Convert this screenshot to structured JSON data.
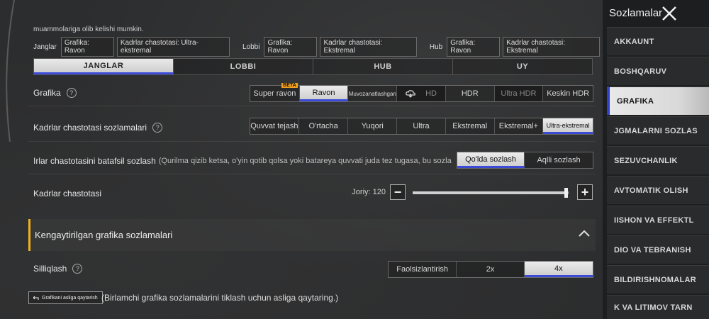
{
  "notice": "muammolariga olib kelishi mumkin.",
  "summary": [
    {
      "label": "Janglar",
      "chips": [
        "Grafika: Ravon",
        "Kadrlar chastotasi: Ultra-ekstremal"
      ]
    },
    {
      "label": "Lobbi",
      "chips": [
        "Grafika: Ravon",
        "Kadrlar chastotasi: Ekstremal"
      ]
    },
    {
      "label": "Hub",
      "chips": [
        "Grafika: Ravon",
        "Kadrlar chastotasi: Ekstremal"
      ]
    }
  ],
  "tabs": [
    "JANGLAR",
    "LOBBI",
    "HUB",
    "UY"
  ],
  "graphics": {
    "label": "Grafika",
    "options": [
      "Super ravon",
      "Ravon",
      "Muvozanatlashgan",
      "HD",
      "HDR",
      "Ultra HDR",
      "Keskin HDR"
    ],
    "badge": "BETA",
    "selected": "Ravon"
  },
  "framerate": {
    "label": "Kadrlar chastotasi sozlamalari",
    "options": [
      "Quvvat tejash",
      "O'rtacha",
      "Yuqori",
      "Ultra",
      "Ekstremal",
      "Ekstremal+",
      "Ultra-ekstremal"
    ],
    "selected": "Ultra-ekstremal"
  },
  "detail": {
    "label": "Irlar chastotasini batafsil sozlash",
    "note": "(Qurilma qizib ketsa, o'yin qotib qolsa yoki batareya quvvati juda tez tugasa, bu sozlamani pasaytiring)",
    "options": [
      "Qo'lda sozlash",
      "Aqlli sozlash"
    ],
    "selected": "Qo'lda sozlash"
  },
  "fps_slider": {
    "label": "Kadrlar chastotasi",
    "value_text": "Joriy: 120",
    "fraction": 0.98
  },
  "advanced": {
    "title": "Kengaytirilgan grafika sozlamalari"
  },
  "antialias": {
    "label": "Silliqlash",
    "options": [
      "Faolsizlantirish",
      "2x",
      "4x"
    ],
    "selected": "4x"
  },
  "reset": {
    "button": "Grafikani asliga qaytarish",
    "note": "(Birlamchi grafika sozlamalarini tiklash uchun asliga qaytaring.)"
  },
  "sidebar": {
    "title": "Sozlamalar",
    "items": [
      "AKKAUNT",
      "BOSHQARUV",
      "GRAFIKA",
      "JGMALARNI SOZLAS",
      "SEZUVCHANLIK",
      "AVTOMATIK OLISH",
      "IISHON VA EFFEKTL",
      "DIO VA TEBRANISH",
      "BILDIRISHNOMALAR",
      "K VA LITIMOV TARN"
    ],
    "active": "GRAFIKA"
  },
  "colors": {
    "accent": "#3b4bd8",
    "section_bar": "#f0b020",
    "beta_badge": "#f0a020"
  }
}
